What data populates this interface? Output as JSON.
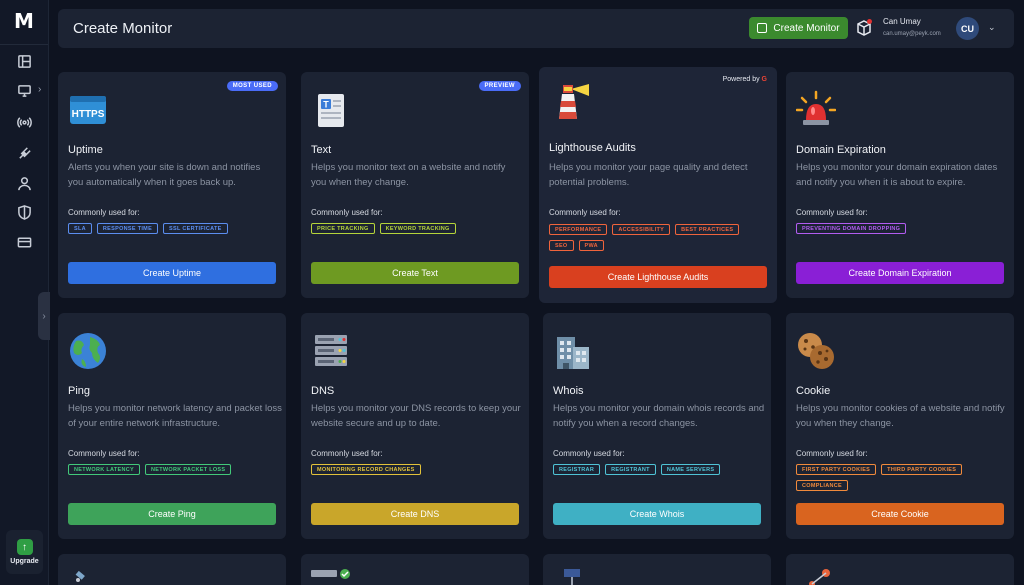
{
  "app": {
    "logo": "M"
  },
  "sidebar": {
    "items": [
      {
        "name": "dashboard-icon"
      },
      {
        "name": "monitor-icon"
      },
      {
        "name": "broadcast-icon"
      },
      {
        "name": "plug-icon"
      },
      {
        "name": "user-icon"
      },
      {
        "name": "shield-icon"
      },
      {
        "name": "credit-card-icon"
      }
    ],
    "chevron": "›",
    "collapse": "›",
    "upgrade_label": "Upgrade"
  },
  "header": {
    "title": "Create Monitor",
    "create_button": "Create Monitor",
    "user_name": "Can Umay",
    "user_email": "can.umay@peyk.com",
    "avatar_initials": "CU",
    "chevron": "⌄"
  },
  "cards": [
    {
      "id": "uptime",
      "title": "Uptime",
      "description": "Alerts you when your site is down and notifies you automatically when it goes back up.",
      "badge": "MOST USED",
      "badge_color": "#4a6cf7",
      "used_label": "Commonly used for:",
      "tags": [
        "SLA",
        "RESPONSE TIME",
        "SSL CERTIFICATE"
      ],
      "tag_color": "#5b8def",
      "button": "Create Uptime",
      "button_color": "#2f6fe0"
    },
    {
      "id": "text",
      "title": "Text",
      "description": "Helps you monitor text on a website and notify you when they change.",
      "badge": "PREVIEW",
      "badge_color": "#4a6cf7",
      "used_label": "Commonly used for:",
      "tags": [
        "PRICE TRACKING",
        "KEYWORD TRACKING"
      ],
      "tag_color": "#b5d43a",
      "button": "Create Text",
      "button_color": "#6e9a22"
    },
    {
      "id": "lighthouse",
      "title": "Lighthouse Audits",
      "description": "Helps you monitor your page quality and detect potential problems.",
      "powered_by": "Powered by",
      "powered_logo": "G",
      "used_label": "Commonly used for:",
      "tags": [
        "PERFORMANCE",
        "ACCESSIBILITY",
        "BEST PRACTICES",
        "SEO",
        "PWA"
      ],
      "tag_color": "#f0643c",
      "button": "Create Lighthouse Audits",
      "button_color": "#d9401f"
    },
    {
      "id": "domain-expiration",
      "title": "Domain Expiration",
      "description": "Helps you monitor your domain expiration dates and notify you when it is about to expire.",
      "used_label": "Commonly used for:",
      "tags": [
        "PREVENTING DOMAIN DROPPING"
      ],
      "tag_color": "#b25cf0",
      "button": "Create Domain Expiration",
      "button_color": "#8a1fd6"
    },
    {
      "id": "ping",
      "title": "Ping",
      "description": "Helps you monitor network latency and packet loss of your entire network infrastructure.",
      "used_label": "Commonly used for:",
      "tags": [
        "NETWORK LATENCY",
        "NETWORK PACKET LOSS"
      ],
      "tag_color": "#42c97a",
      "button": "Create Ping",
      "button_color": "#3ea35a"
    },
    {
      "id": "dns",
      "title": "DNS",
      "description": "Helps you monitor your DNS records to keep your website secure and up to date.",
      "used_label": "Commonly used for:",
      "tags": [
        "MONITORING RECORD CHANGES"
      ],
      "tag_color": "#e2c23a",
      "button": "Create DNS",
      "button_color": "#c9a62a"
    },
    {
      "id": "whois",
      "title": "Whois",
      "description": "Helps you monitor your domain whois records and notify you when a record changes.",
      "used_label": "Commonly used for:",
      "tags": [
        "REGISTRAR",
        "REGISTRANT",
        "NAME SERVERS"
      ],
      "tag_color": "#4fc3d6",
      "button": "Create Whois",
      "button_color": "#3fb0c4"
    },
    {
      "id": "cookie",
      "title": "Cookie",
      "description": "Helps you monitor cookies of a website and notify you when they change.",
      "used_label": "Commonly used for:",
      "tags": [
        "FIRST PARTY COOKIES",
        "THIRD PARTY COOKIES",
        "COMPLIANCE"
      ],
      "tag_color": "#f08a3c",
      "button": "Create Cookie",
      "button_color": "#d9641f"
    }
  ]
}
